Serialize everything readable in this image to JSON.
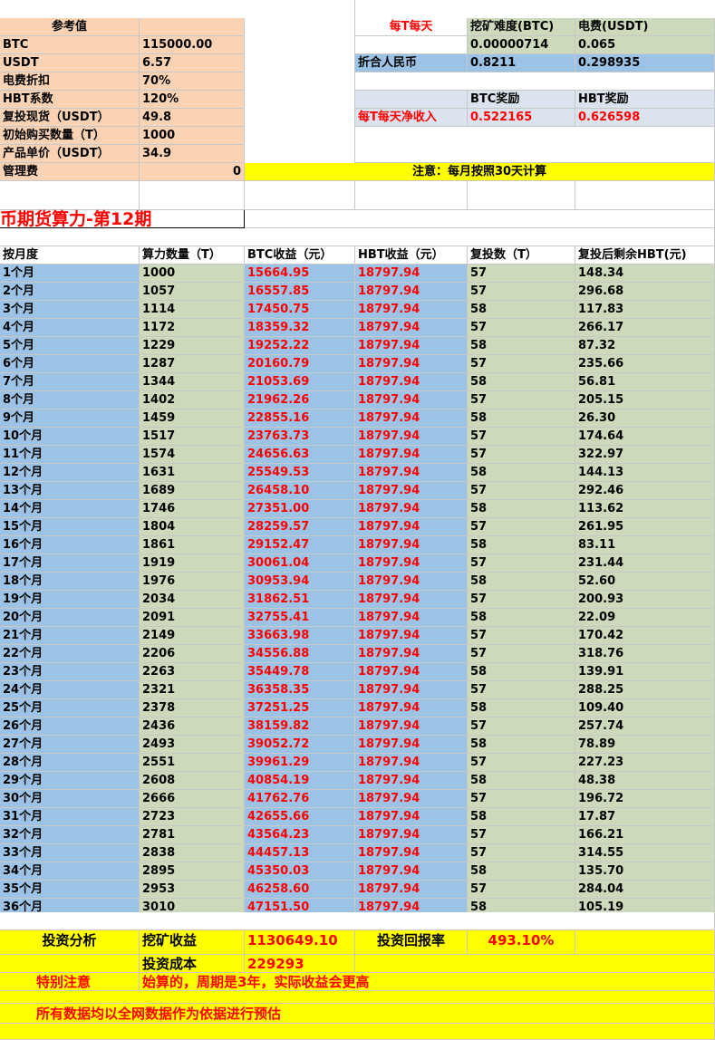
{
  "reference": {
    "title": "参考值",
    "rows": [
      {
        "label": "BTC",
        "value": "115000.00"
      },
      {
        "label": "USDT",
        "value": "6.57"
      },
      {
        "label": "电费折扣",
        "value": "70%"
      },
      {
        "label": "HBT系数",
        "value": "120%"
      },
      {
        "label": "复投现货（USDT）",
        "value": "49.8"
      },
      {
        "label": "初始购买数量（T）",
        "value": "1000"
      },
      {
        "label": "产品单价（USDT）",
        "value": "34.9"
      },
      {
        "label": "管理费",
        "value": "0"
      }
    ]
  },
  "mining": {
    "per_t_label": "每T每天",
    "difficulty_header": "挖矿难度(BTC)",
    "power_header": "电费(USDT)",
    "difficulty_value": "0.00000714",
    "power_value": "0.065",
    "rmb_label": "折合人民币",
    "rmb_difficulty": "0.8211",
    "rmb_power": "0.298935",
    "btc_reward_header": "BTC奖励",
    "hbt_reward_header": "HBT奖励",
    "net_income_label": "每T每天净收入",
    "btc_reward": "0.522165",
    "hbt_reward": "0.626598",
    "note": "注意：每月按照30天计算"
  },
  "banner": "币期货算力-第12期",
  "table": {
    "headers": [
      "按月度",
      "算力数量（T）",
      "BTC收益（元）",
      "HBT收益（元）",
      "复投数（T）",
      "复投后剩余HBT(元)"
    ],
    "rows": [
      [
        "1个月",
        "1000",
        "15664.95",
        "18797.94",
        "57",
        "148.34"
      ],
      [
        "2个月",
        "1057",
        "16557.85",
        "18797.94",
        "57",
        "296.68"
      ],
      [
        "3个月",
        "1114",
        "17450.75",
        "18797.94",
        "58",
        "117.83"
      ],
      [
        "4个月",
        "1172",
        "18359.32",
        "18797.94",
        "57",
        "266.17"
      ],
      [
        "5个月",
        "1229",
        "19252.22",
        "18797.94",
        "58",
        "87.32"
      ],
      [
        "6个月",
        "1287",
        "20160.79",
        "18797.94",
        "57",
        "235.66"
      ],
      [
        "7个月",
        "1344",
        "21053.69",
        "18797.94",
        "58",
        "56.81"
      ],
      [
        "8个月",
        "1402",
        "21962.26",
        "18797.94",
        "57",
        "205.15"
      ],
      [
        "9个月",
        "1459",
        "22855.16",
        "18797.94",
        "58",
        "26.30"
      ],
      [
        "10个月",
        "1517",
        "23763.73",
        "18797.94",
        "57",
        "174.64"
      ],
      [
        "11个月",
        "1574",
        "24656.63",
        "18797.94",
        "57",
        "322.97"
      ],
      [
        "12个月",
        "1631",
        "25549.53",
        "18797.94",
        "58",
        "144.13"
      ],
      [
        "13个月",
        "1689",
        "26458.10",
        "18797.94",
        "57",
        "292.46"
      ],
      [
        "14个月",
        "1746",
        "27351.00",
        "18797.94",
        "58",
        "113.62"
      ],
      [
        "15个月",
        "1804",
        "28259.57",
        "18797.94",
        "57",
        "261.95"
      ],
      [
        "16个月",
        "1861",
        "29152.47",
        "18797.94",
        "58",
        "83.11"
      ],
      [
        "17个月",
        "1919",
        "30061.04",
        "18797.94",
        "57",
        "231.44"
      ],
      [
        "18个月",
        "1976",
        "30953.94",
        "18797.94",
        "58",
        "52.60"
      ],
      [
        "19个月",
        "2034",
        "31862.51",
        "18797.94",
        "57",
        "200.93"
      ],
      [
        "20个月",
        "2091",
        "32755.41",
        "18797.94",
        "58",
        "22.09"
      ],
      [
        "21个月",
        "2149",
        "33663.98",
        "18797.94",
        "57",
        "170.42"
      ],
      [
        "22个月",
        "2206",
        "34556.88",
        "18797.94",
        "57",
        "318.76"
      ],
      [
        "23个月",
        "2263",
        "35449.78",
        "18797.94",
        "58",
        "139.91"
      ],
      [
        "24个月",
        "2321",
        "36358.35",
        "18797.94",
        "57",
        "288.25"
      ],
      [
        "25个月",
        "2378",
        "37251.25",
        "18797.94",
        "58",
        "109.40"
      ],
      [
        "26个月",
        "2436",
        "38159.82",
        "18797.94",
        "57",
        "257.74"
      ],
      [
        "27个月",
        "2493",
        "39052.72",
        "18797.94",
        "58",
        "78.89"
      ],
      [
        "28个月",
        "2551",
        "39961.29",
        "18797.94",
        "57",
        "227.23"
      ],
      [
        "29个月",
        "2608",
        "40854.19",
        "18797.94",
        "58",
        "48.38"
      ],
      [
        "30个月",
        "2666",
        "41762.76",
        "18797.94",
        "57",
        "196.72"
      ],
      [
        "31个月",
        "2723",
        "42655.66",
        "18797.94",
        "58",
        "17.87"
      ],
      [
        "32个月",
        "2781",
        "43564.23",
        "18797.94",
        "57",
        "166.21"
      ],
      [
        "33个月",
        "2838",
        "44457.13",
        "18797.94",
        "57",
        "314.55"
      ],
      [
        "34个月",
        "2895",
        "45350.03",
        "18797.94",
        "58",
        "135.70"
      ],
      [
        "35个月",
        "2953",
        "46258.60",
        "18797.94",
        "57",
        "284.04"
      ],
      [
        "36个月",
        "3010",
        "47151.50",
        "18797.94",
        "58",
        "105.19"
      ]
    ]
  },
  "summary": {
    "analysis_label": "投资分析",
    "mining_income_label": "挖矿收益",
    "mining_income_value": "1130649.10",
    "roi_label": "投资回报率",
    "roi_value": "493.10%",
    "cost_label": "投资成本",
    "cost_value": "229293",
    "note1_label": "特别注意",
    "note1_text": "始算的，周期是3年，实际收益会更高",
    "note2_text": "所有数据均以全网数据作为依据进行预估"
  }
}
